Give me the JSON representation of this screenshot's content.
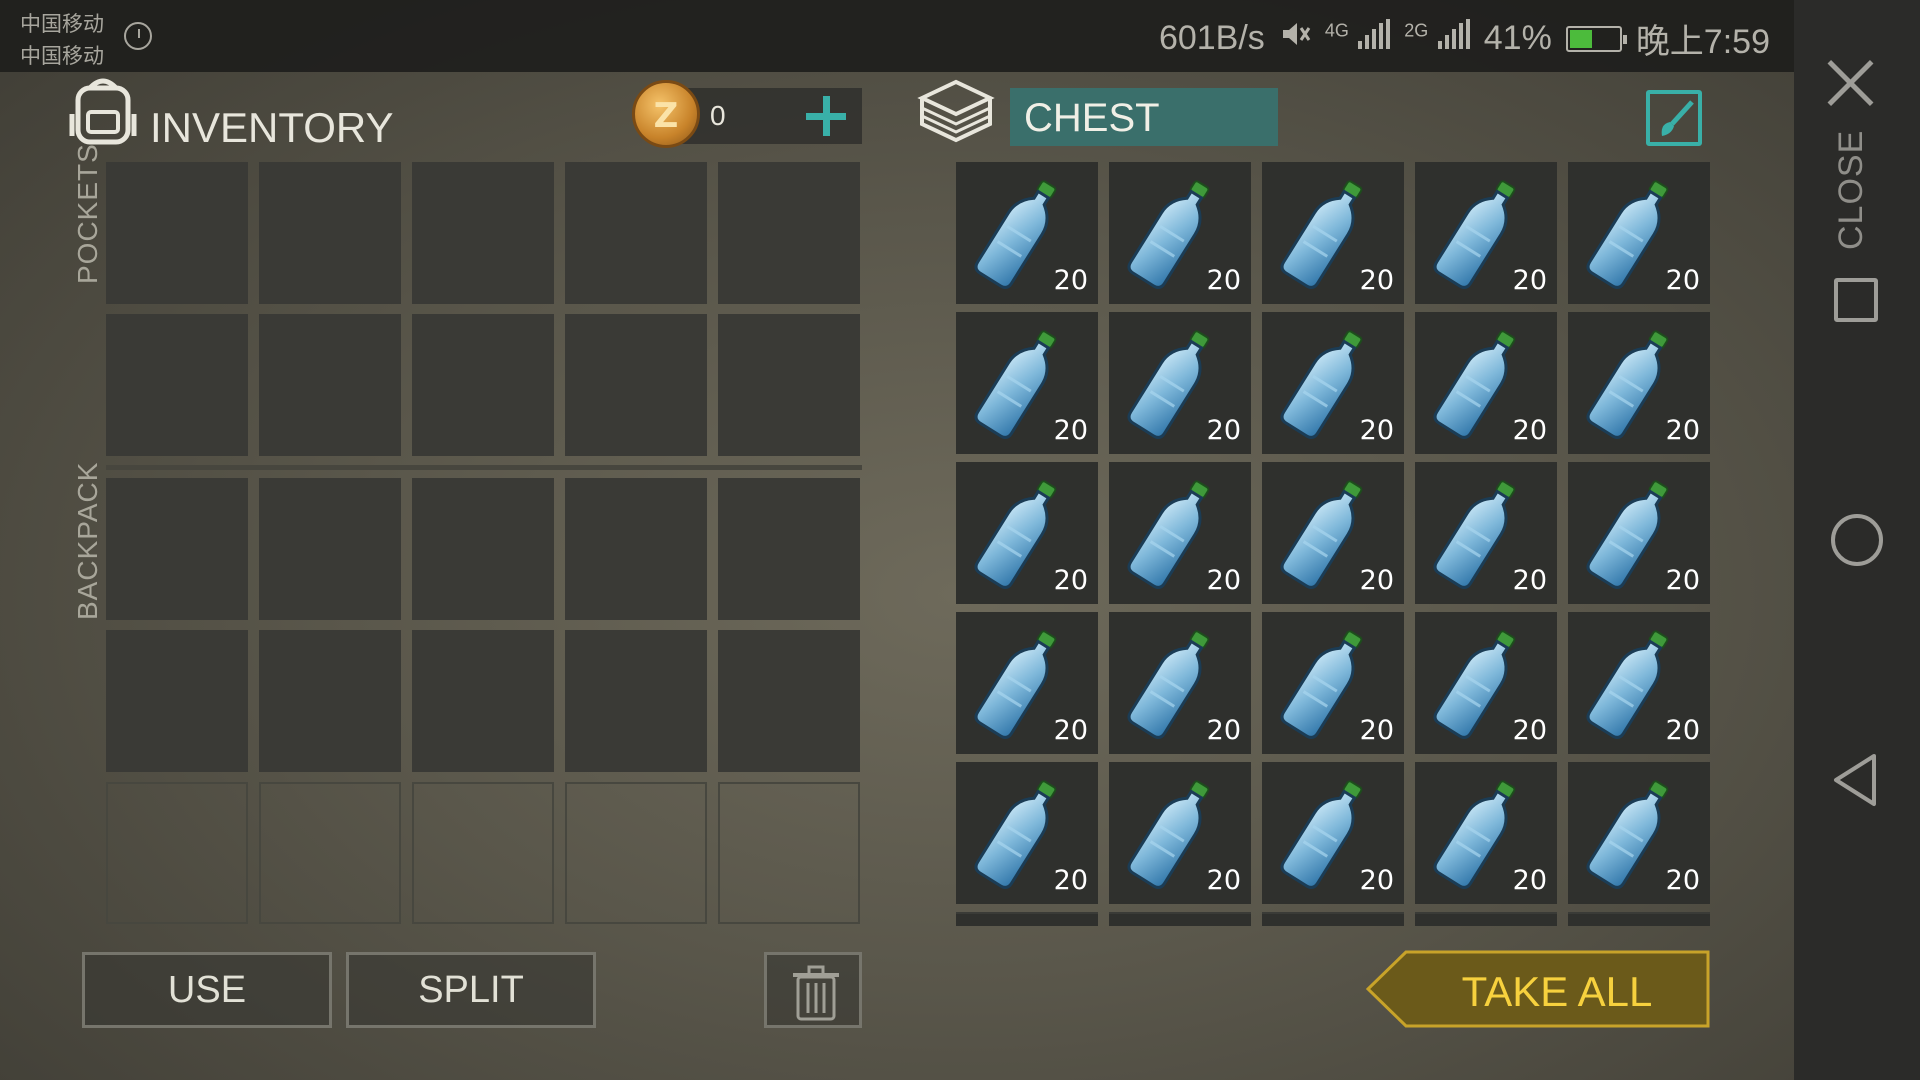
{
  "status_bar": {
    "carrier_1": "中国移动",
    "carrier_2": "中国移动",
    "net_speed": "601B/s",
    "net_4g": "4G",
    "net_2g": "2G",
    "battery": "41%",
    "time": "晚上7:59"
  },
  "inventory": {
    "title": "INVENTORY",
    "coins": "0",
    "pockets_label": "POCKETS",
    "backpack_label": "BACKPACK"
  },
  "chest": {
    "title": "CHEST",
    "item_name": "water-bottle",
    "quantities": [
      "20",
      "20",
      "20",
      "20",
      "20",
      "20",
      "20",
      "20",
      "20",
      "20",
      "20",
      "20",
      "20",
      "20",
      "20",
      "20",
      "20",
      "20",
      "20",
      "20",
      "20",
      "20",
      "20",
      "20",
      "20"
    ]
  },
  "buttons": {
    "use": "USE",
    "split": "SPLIT",
    "take_all": "TAKE ALL"
  },
  "navigation": {
    "close_label": "CLOSE"
  },
  "colors": {
    "accent_teal": "#39b0a8",
    "chest_title_bg": "#3a6f6b",
    "take_all_gold": "#f7d13e"
  }
}
